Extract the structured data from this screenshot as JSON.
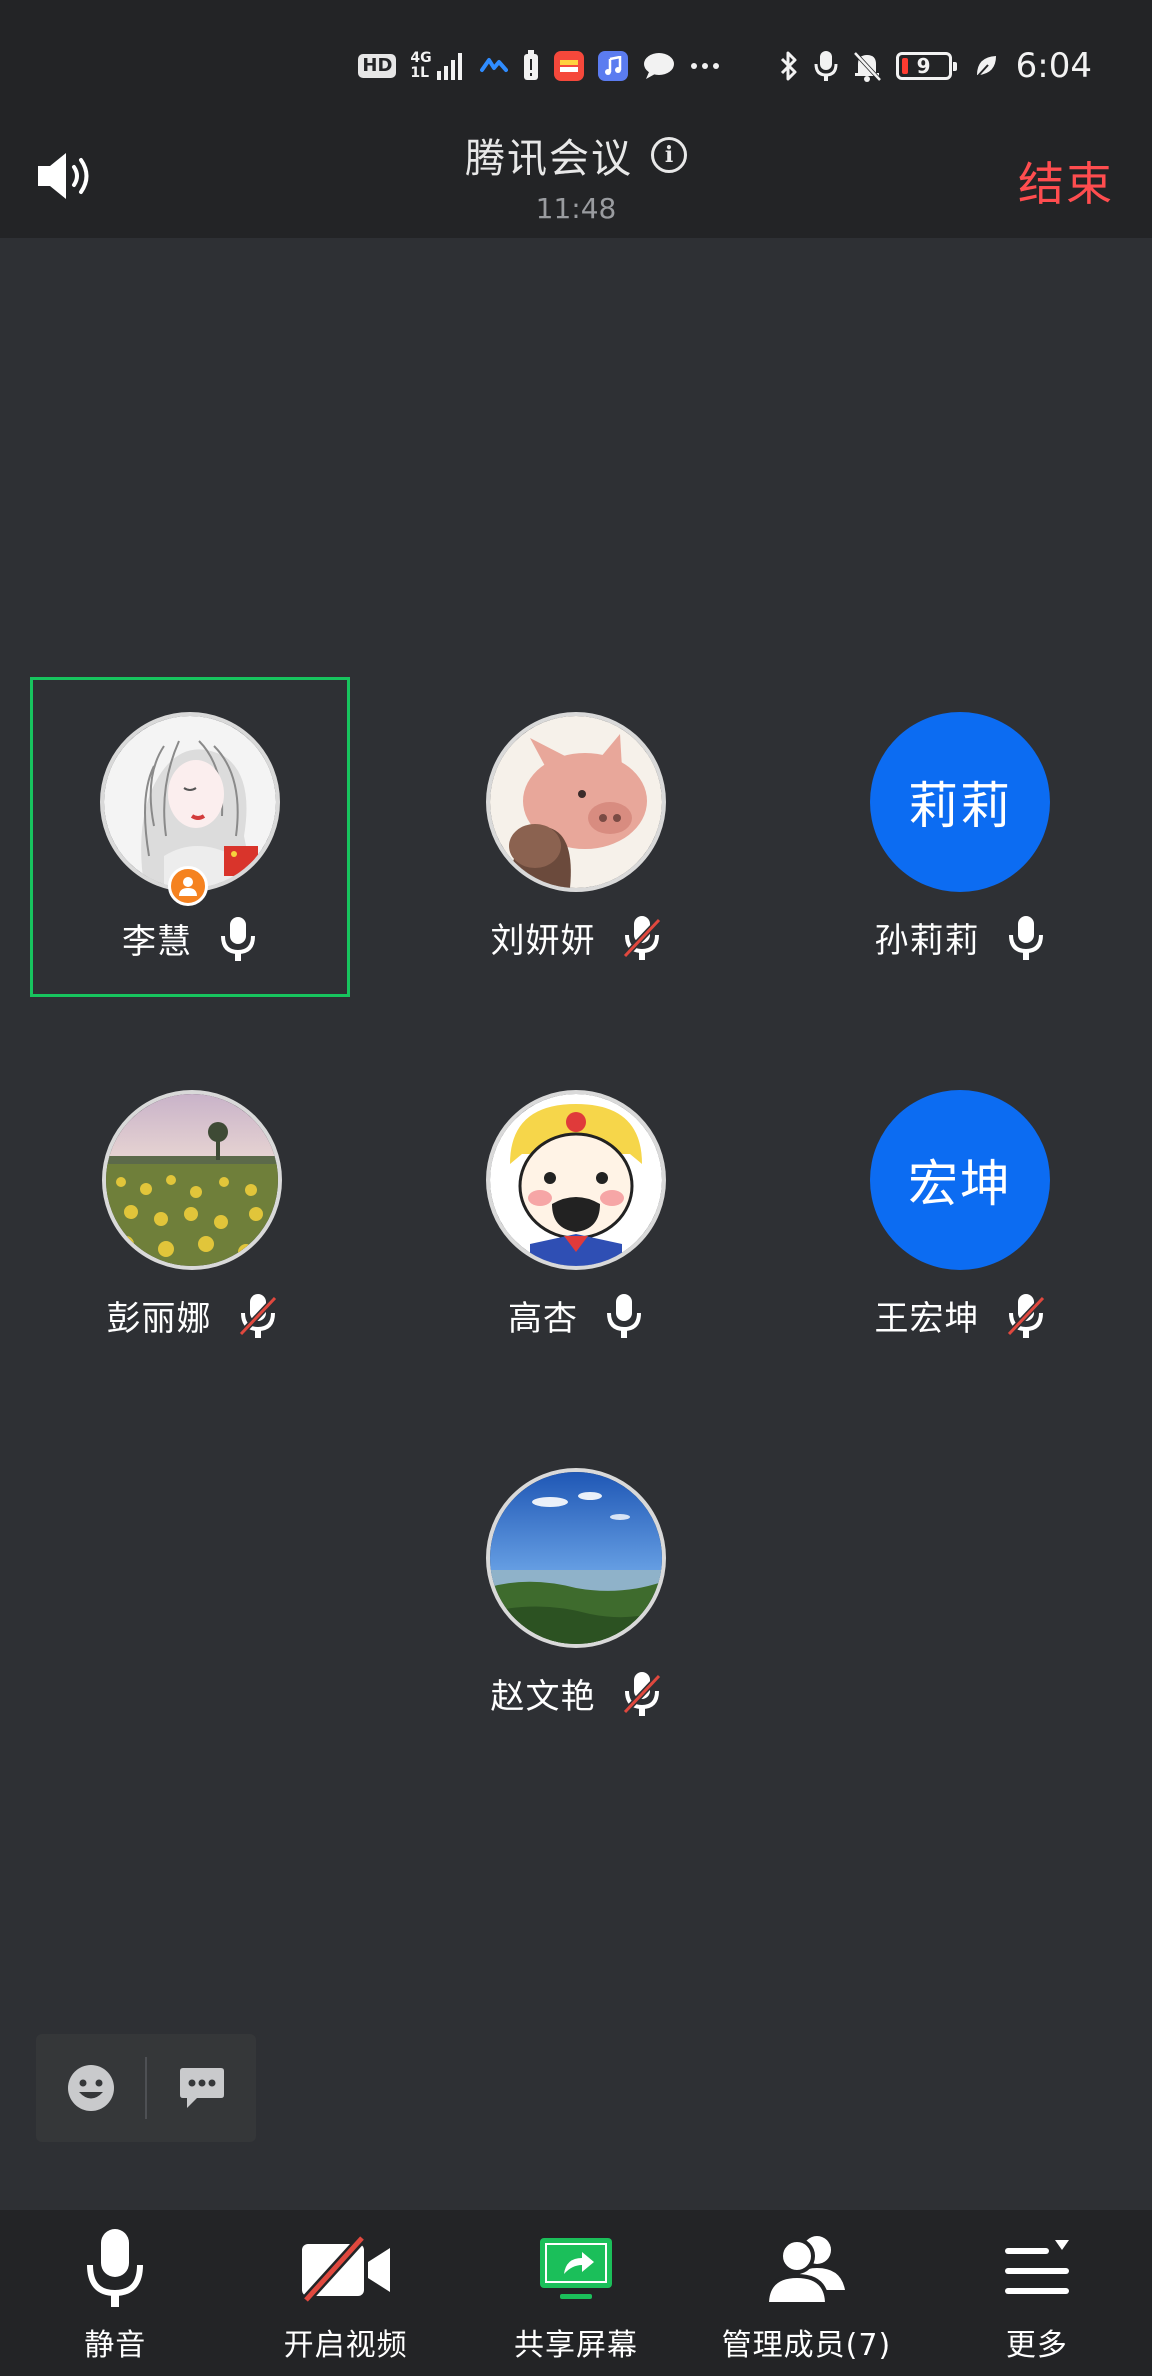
{
  "status_bar": {
    "hd_label": "HD",
    "network_label_top": "4G",
    "network_label_bottom": "1L",
    "battery_level": "9",
    "time": "6:04",
    "icons": [
      "hd-icon",
      "signal-icon",
      "app-icon",
      "battery-alert-icon",
      "app-icon",
      "music-icon",
      "chat-icon",
      "more-icon",
      "bluetooth-icon",
      "mic-icon",
      "mute-bell-icon",
      "battery-icon",
      "leaf-icon"
    ]
  },
  "header": {
    "title": "腾讯会议",
    "timer": "11:48",
    "end_label": "结束",
    "end_color": "#ff4d4f"
  },
  "participants": [
    {
      "name": "李慧",
      "avatar": "photo",
      "avatar_desc_icon": "sketch-portrait-avatar",
      "mic": "on",
      "host": true,
      "selected": true
    },
    {
      "name": "刘妍妍",
      "avatar": "photo",
      "avatar_desc_icon": "pig-avatar",
      "mic": "muted",
      "host": false,
      "selected": false
    },
    {
      "name": "孙莉莉",
      "avatar": "text",
      "avatar_text": "莉莉",
      "mic": "on",
      "host": false,
      "selected": false
    },
    {
      "name": "彭丽娜",
      "avatar": "photo",
      "avatar_desc_icon": "sunflower-field-avatar",
      "mic": "muted",
      "host": false,
      "selected": false
    },
    {
      "name": "高杏",
      "avatar": "photo",
      "avatar_desc_icon": "cartoon-sailor-avatar",
      "mic": "on",
      "host": false,
      "selected": false
    },
    {
      "name": "王宏坤",
      "avatar": "text",
      "avatar_text": "宏坤",
      "mic": "muted",
      "host": false,
      "selected": false
    },
    {
      "name": "赵文艳",
      "avatar": "photo",
      "avatar_desc_icon": "sky-landscape-avatar",
      "mic": "muted",
      "host": false,
      "selected": false
    }
  ],
  "colors": {
    "background": "#2e3034",
    "bar": "#232426",
    "avatar_blue": "#0c6cf2",
    "selected_border": "#17c45e",
    "host_badge": "#f58220",
    "share_green": "#1bbf5a",
    "video_off_red": "#e0483e"
  },
  "toolbar": {
    "items": [
      {
        "label": "静音",
        "icon": "microphone-icon"
      },
      {
        "label": "开启视频",
        "icon": "video-off-icon"
      },
      {
        "label": "共享屏幕",
        "icon": "share-screen-icon"
      },
      {
        "label": "管理成员(7)",
        "icon": "members-icon"
      },
      {
        "label": "更多",
        "icon": "more-menu-icon"
      }
    ]
  }
}
